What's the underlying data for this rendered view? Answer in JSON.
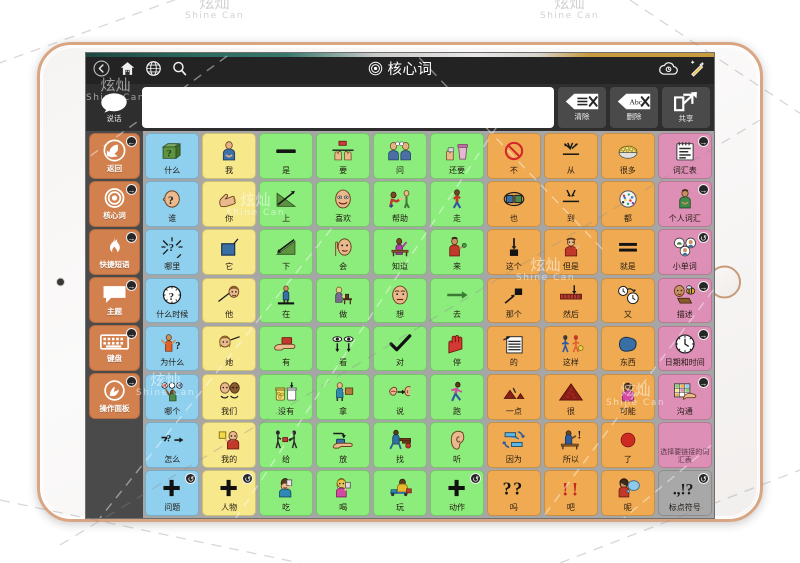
{
  "app": {
    "title": "核心词",
    "title_icon": "target-icon"
  },
  "navbar": {
    "back_icon": "back-arrow-icon",
    "home_icon": "home-icon",
    "globe_icon": "globe-icon",
    "search_icon": "search-icon",
    "cloud_icon": "cloud-sync-icon",
    "edit_icon": "magic-wand-edit-icon"
  },
  "messagebar": {
    "speak_label": "说话",
    "speak_icon": "speech-bubble-icon",
    "input_value": "",
    "input_placeholder": "",
    "clear_label": "清除",
    "clear_icon": "clear-all-icon",
    "delete_label": "删除",
    "delete_icon": "delete-word-icon",
    "share_label": "共享",
    "share_icon": "share-icon"
  },
  "sidebar": {
    "items": [
      {
        "label": "返回",
        "icon": "back-hand-icon",
        "badge": "←",
        "color": "#d2814e"
      },
      {
        "label": "核心词",
        "icon": "target-icon",
        "badge": "→",
        "color": "#d2814e"
      },
      {
        "label": "快捷短语",
        "icon": "flame-icon",
        "badge": "→",
        "color": "#d2814e"
      },
      {
        "label": "主题",
        "icon": "speech-bubble-icon",
        "badge": "→",
        "color": "#d2814e"
      },
      {
        "label": "键盘",
        "icon": "keyboard-icon",
        "badge": "→",
        "color": "#d2814e"
      },
      {
        "label": "操作面板",
        "icon": "control-panel-icon",
        "badge": "→",
        "color": "#d2814e"
      }
    ]
  },
  "grid": {
    "columns": 10,
    "rows": 8,
    "colors": {
      "question": "#8fd0ef",
      "pronoun": "#f7e88c",
      "verb": "#8ced7c",
      "modifier": "#f0ab52",
      "category": "#dd8fb5",
      "punctuation": "#a8a8a8"
    },
    "cells": [
      {
        "label": "什么",
        "color": "question",
        "icon": "green-box-question-icon"
      },
      {
        "label": "我",
        "color": "pronoun",
        "icon": "person-self-icon"
      },
      {
        "label": "是",
        "color": "verb",
        "icon": "black-bar-icon"
      },
      {
        "label": "要",
        "color": "verb",
        "icon": "hands-want-icon"
      },
      {
        "label": "问",
        "color": "verb",
        "icon": "two-people-talking-icon"
      },
      {
        "label": "还要",
        "color": "verb",
        "icon": "hand-cup-more-icon"
      },
      {
        "label": "不",
        "color": "modifier",
        "icon": "no-circle-slash-icon"
      },
      {
        "label": "从",
        "color": "modifier",
        "icon": "arrows-from-icon"
      },
      {
        "label": "很多",
        "color": "modifier",
        "icon": "bowl-many-icon"
      },
      {
        "label": "词汇表",
        "color": "category",
        "icon": "notepad-icon",
        "badge": "→"
      },
      {
        "label": "谁",
        "color": "question",
        "icon": "head-question-icon"
      },
      {
        "label": "你",
        "color": "pronoun",
        "icon": "pointing-hand-icon"
      },
      {
        "label": "上",
        "color": "verb",
        "icon": "ramp-up-arrow-icon"
      },
      {
        "label": "喜欢",
        "color": "verb",
        "icon": "smiling-face-icon"
      },
      {
        "label": "帮助",
        "color": "verb",
        "icon": "helping-hand-icon"
      },
      {
        "label": "走",
        "color": "verb",
        "icon": "walking-person-icon"
      },
      {
        "label": "也",
        "color": "modifier",
        "icon": "two-squares-oval-icon"
      },
      {
        "label": "到",
        "color": "modifier",
        "icon": "arrows-to-icon"
      },
      {
        "label": "都",
        "color": "modifier",
        "icon": "dotted-plate-icon"
      },
      {
        "label": "个人词汇",
        "color": "category",
        "icon": "person-green-icon",
        "badge": "→"
      },
      {
        "label": "哪里",
        "color": "question",
        "icon": "question-rays-icon"
      },
      {
        "label": "它",
        "color": "pronoun",
        "icon": "blue-square-icon"
      },
      {
        "label": "下",
        "color": "verb",
        "icon": "ramp-down-arrow-icon"
      },
      {
        "label": "会",
        "color": "verb",
        "icon": "head-raise-hand-icon"
      },
      {
        "label": "知道",
        "color": "verb",
        "icon": "student-desk-icon"
      },
      {
        "label": "来",
        "color": "verb",
        "icon": "person-come-icon"
      },
      {
        "label": "这个",
        "color": "modifier",
        "icon": "arrow-down-square-icon"
      },
      {
        "label": "但是",
        "color": "modifier",
        "icon": "person-but-icon"
      },
      {
        "label": "就是",
        "color": "modifier",
        "icon": "equals-bars-icon"
      },
      {
        "label": "小单词",
        "color": "category",
        "icon": "three-circles-icon",
        "badge": "↺"
      },
      {
        "label": "什么时候",
        "color": "question",
        "icon": "clock-question-icon"
      },
      {
        "label": "他",
        "color": "pronoun",
        "icon": "pointing-to-head-icon"
      },
      {
        "label": "在",
        "color": "verb",
        "icon": "person-standing-platform-icon"
      },
      {
        "label": "做",
        "color": "verb",
        "icon": "person-working-icon"
      },
      {
        "label": "想",
        "color": "verb",
        "icon": "thinking-face-icon"
      },
      {
        "label": "去",
        "color": "verb",
        "icon": "right-arrow-icon"
      },
      {
        "label": "那个",
        "color": "modifier",
        "icon": "arrow-to-square-icon"
      },
      {
        "label": "然后",
        "color": "modifier",
        "icon": "timeline-arrow-icon"
      },
      {
        "label": "又",
        "color": "modifier",
        "icon": "two-clocks-icon"
      },
      {
        "label": "描述",
        "color": "category",
        "icon": "face-bee-icon",
        "badge": "→"
      },
      {
        "label": "为什么",
        "color": "question",
        "icon": "shrug-question-icon"
      },
      {
        "label": "她",
        "color": "pronoun",
        "icon": "pointing-to-woman-icon"
      },
      {
        "label": "有",
        "color": "verb",
        "icon": "hand-holding-block-icon"
      },
      {
        "label": "看",
        "color": "verb",
        "icon": "two-eyes-icon"
      },
      {
        "label": "对",
        "color": "verb",
        "icon": "check-mark-icon"
      },
      {
        "label": "停",
        "color": "verb",
        "icon": "red-hand-stop-icon"
      },
      {
        "label": "的",
        "color": "modifier",
        "icon": "lined-paper-icon"
      },
      {
        "label": "这样",
        "color": "modifier",
        "icon": "two-kids-ball-icon"
      },
      {
        "label": "东西",
        "color": "modifier",
        "icon": "blue-blob-icon"
      },
      {
        "label": "日期和时间",
        "color": "category",
        "icon": "clock-icon",
        "badge": "→"
      },
      {
        "label": "哪个",
        "color": "question",
        "icon": "choose-three-icon"
      },
      {
        "label": "我们",
        "color": "pronoun",
        "icon": "two-heads-icon"
      },
      {
        "label": "没有",
        "color": "verb",
        "icon": "empty-jar-icon"
      },
      {
        "label": "拿",
        "color": "verb",
        "icon": "person-carry-box-icon"
      },
      {
        "label": "说",
        "color": "verb",
        "icon": "mouth-ear-icon"
      },
      {
        "label": "跑",
        "color": "verb",
        "icon": "running-person-icon"
      },
      {
        "label": "一点",
        "color": "modifier",
        "icon": "small-pile-icon"
      },
      {
        "label": "很",
        "color": "modifier",
        "icon": "big-pile-icon"
      },
      {
        "label": "可能",
        "color": "modifier",
        "icon": "woman-maybe-icon"
      },
      {
        "label": "沟通",
        "color": "category",
        "icon": "grid-hand-icon",
        "badge": "→"
      },
      {
        "label": "怎么",
        "color": "question",
        "icon": "arrow-question-icon"
      },
      {
        "label": "我的",
        "color": "pronoun",
        "icon": "person-holding-square-icon"
      },
      {
        "label": "给",
        "color": "verb",
        "icon": "give-between-people-icon"
      },
      {
        "label": "放",
        "color": "verb",
        "icon": "hand-put-icon"
      },
      {
        "label": "找",
        "color": "verb",
        "icon": "person-searching-icon"
      },
      {
        "label": "听",
        "color": "verb",
        "icon": "ear-icon"
      },
      {
        "label": "因为",
        "color": "modifier",
        "icon": "cycle-arrows-icon"
      },
      {
        "label": "所以",
        "color": "modifier",
        "icon": "teacher-pointing-icon"
      },
      {
        "label": "了",
        "color": "modifier",
        "icon": "red-dot-icon"
      },
      {
        "label": "选择要链接的词汇表",
        "color": "category-blank",
        "icon": ""
      },
      {
        "label": "问题",
        "color": "question",
        "icon": "plus-icon",
        "badge": "↺"
      },
      {
        "label": "人物",
        "color": "pronoun",
        "icon": "plus-icon",
        "badge": "↺"
      },
      {
        "label": "吃",
        "color": "verb",
        "icon": "person-drinking-icon"
      },
      {
        "label": "喝",
        "color": "verb",
        "icon": "woman-drinking-icon"
      },
      {
        "label": "玩",
        "color": "verb",
        "icon": "child-playing-icon"
      },
      {
        "label": "动作",
        "color": "verb",
        "icon": "plus-icon",
        "badge": "↺"
      },
      {
        "label": "吗",
        "color": "modifier",
        "icon": "two-question-marks-icon"
      },
      {
        "label": "吧",
        "color": "modifier",
        "icon": "two-exclamation-marks-icon"
      },
      {
        "label": "呢",
        "color": "modifier",
        "icon": "person-thought-icon"
      },
      {
        "label": "标点符号",
        "color": "punctuation",
        "icon": "punctuation-icon",
        "badge": "↺"
      }
    ]
  },
  "watermark": {
    "big": "炫灿",
    "small": "Shine Can"
  }
}
